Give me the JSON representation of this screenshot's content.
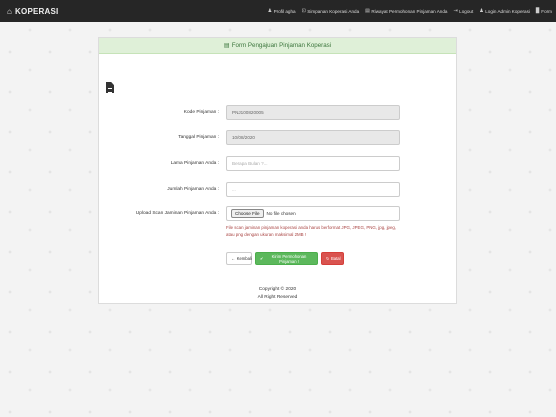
{
  "navbar": {
    "brand": "KOPERASI",
    "brand_icon": "home-icon",
    "links": [
      {
        "icon": "user-icon",
        "glyph": "♟",
        "label": "Profil agha"
      },
      {
        "icon": "savings-icon",
        "glyph": "⊡",
        "label": "Simpanan Koperasi Anda"
      },
      {
        "icon": "history-icon",
        "glyph": "▤",
        "label": "Riwayat Permohonan Pinjaman Anda"
      },
      {
        "icon": "logout-icon",
        "glyph": "⇥",
        "label": "Logout"
      },
      {
        "icon": "admin-icon",
        "glyph": "♟",
        "label": "Login Admin Koperasi"
      },
      {
        "icon": "form-icon",
        "glyph": "▉",
        "label": "Form"
      }
    ]
  },
  "panel": {
    "heading": "Form Pengajuan Pinjaman Koperasi",
    "heading_icon": "file-icon"
  },
  "form": {
    "kode_label": "Kode Pinjaman :",
    "kode_value": "PNJ100820005",
    "tanggal_label": "Tanggal Pinjaman :",
    "tanggal_value": "10/08/2020",
    "lama_label": "Lama Pinjaman Anda :",
    "lama_placeholder": "Berapa Bulan ?...",
    "jumlah_label": "Jumlah Pinjaman Anda :",
    "jumlah_placeholder": "...",
    "upload_label": "Upload Scan Jaminan Pinjaman Anda :",
    "choose_file": "Choose File",
    "no_file": "No file chosen",
    "help_text": "File scan jaminan pinjaman koperasi anda harus berformat JPG, JPEG, PNG, jpg, jpeg, atau png dengan ukuran maksimal 2MB !",
    "back_label": "Kembali",
    "submit_label": "Kirim Permohonan Pinjaman !",
    "reset_label": "Batal"
  },
  "footer": {
    "copyright": "Copyright © 2020",
    "rights": "All Right Reserved"
  },
  "colors": {
    "navbar": "#262626",
    "heading_bg": "#dff0d8",
    "success": "#5cb85c",
    "danger": "#d9534f",
    "help_text": "#a94442"
  }
}
